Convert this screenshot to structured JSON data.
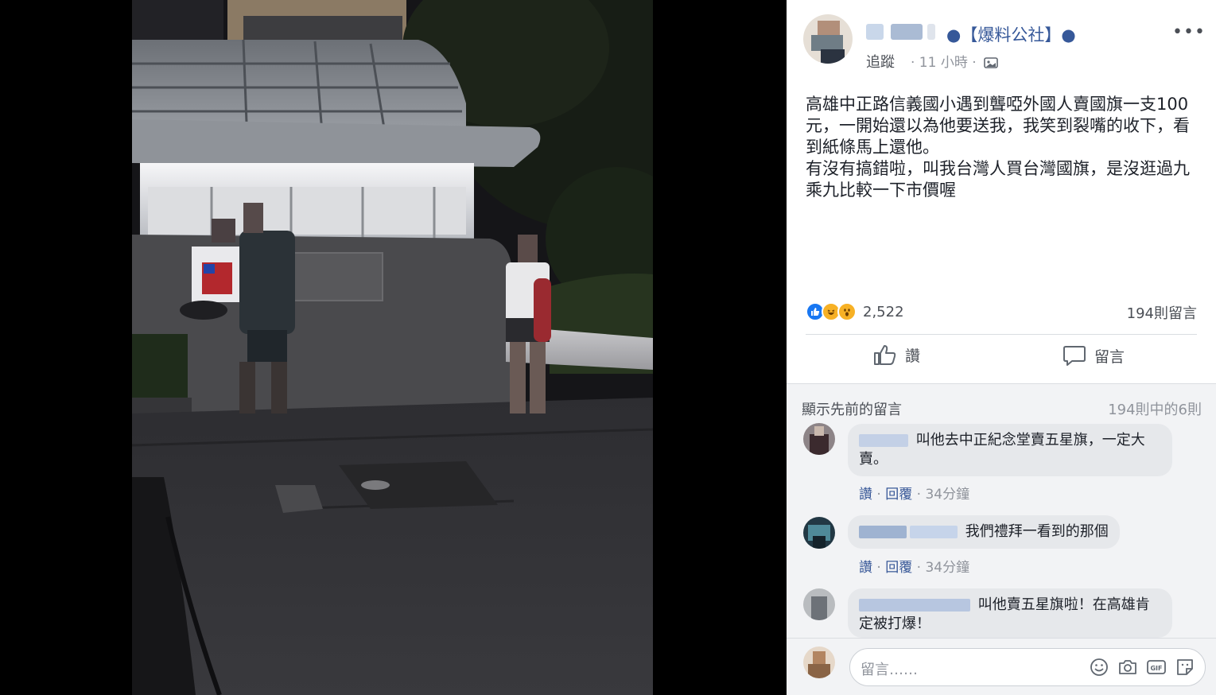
{
  "post": {
    "page_name": "●【爆料公社】●",
    "follow": "追蹤",
    "meta": "· 11 小時 ·",
    "text": "高雄中正路信義國小遇到聾啞外國人賣國旗一支100元，一開始還以為他要送我，我笑到裂嘴的收下，看到紙條馬上還他。\n有沒有搞錯啦，叫我台灣人買台灣國旗，是沒逛過九乘九比較一下市價喔",
    "reaction_count": "2,522",
    "comment_count": "194則留言",
    "like_label": "讚",
    "comment_label": "留言"
  },
  "comments": {
    "show_previous": "顯示先前的留言",
    "range": "194則中的6則",
    "items": [
      {
        "text": "叫他去中正紀念堂賣五星旗，一定大賣。",
        "like": "讚",
        "reply": "回覆",
        "time": "34分鐘"
      },
      {
        "text": "我們禮拜一看到的那個",
        "like": "讚",
        "reply": "回覆",
        "time": "34分鐘"
      },
      {
        "text": "叫他賣五星旗啦！在高雄肯定被打爆！"
      }
    ]
  },
  "composer": {
    "placeholder": "留言……"
  },
  "icons": [
    "more-icon",
    "photo-icon",
    "like-icon",
    "comment-icon",
    "emoji-icon",
    "camera-icon",
    "gif-icon",
    "sticker-icon"
  ],
  "colors": {
    "link": "#365899",
    "bubble": "#e6e8eb",
    "like_blue": "#1877f2",
    "haha_yellow": "#f7b125"
  }
}
